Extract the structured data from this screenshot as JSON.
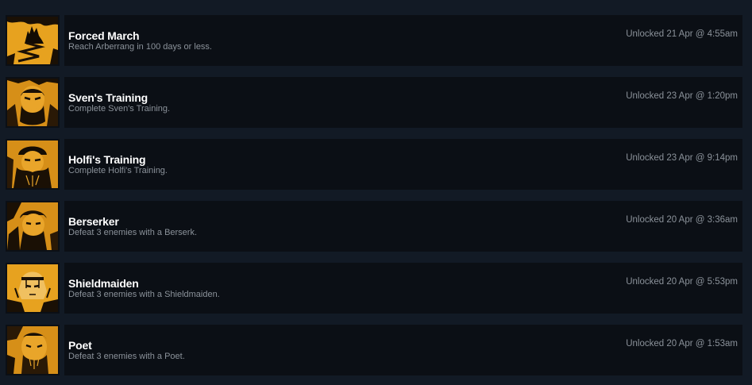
{
  "achievements": [
    {
      "title": "Forced March",
      "description": "Reach Arberrang in 100 days or less.",
      "unlocked": "Unlocked 21 Apr @ 4:55am",
      "icon": "zigzag-path-icon"
    },
    {
      "title": "Sven's Training",
      "description": "Complete Sven's Training.",
      "unlocked": "Unlocked 23 Apr @ 1:20pm",
      "icon": "sven-portrait-icon"
    },
    {
      "title": "Holfi's Training",
      "description": "Complete Holfi's Training.",
      "unlocked": "Unlocked 23 Apr @ 9:14pm",
      "icon": "holfi-portrait-icon"
    },
    {
      "title": "Berserker",
      "description": "Defeat 3 enemies with a Berserk.",
      "unlocked": "Unlocked 20 Apr @ 3:36am",
      "icon": "berserker-portrait-icon"
    },
    {
      "title": "Shieldmaiden",
      "description": "Defeat 3 enemies with a Shieldmaiden.",
      "unlocked": "Unlocked 20 Apr @ 5:53pm",
      "icon": "shieldmaiden-portrait-icon"
    },
    {
      "title": "Poet",
      "description": "Defeat 3 enemies with a Poet.",
      "unlocked": "Unlocked 20 Apr @ 1:53am",
      "icon": "poet-portrait-icon"
    }
  ],
  "colors": {
    "page_background": "#121a25",
    "row_background": "#0b0f15",
    "title": "#ffffff",
    "muted_text": "#8b929a",
    "icon_accent": "#e7a21f"
  }
}
